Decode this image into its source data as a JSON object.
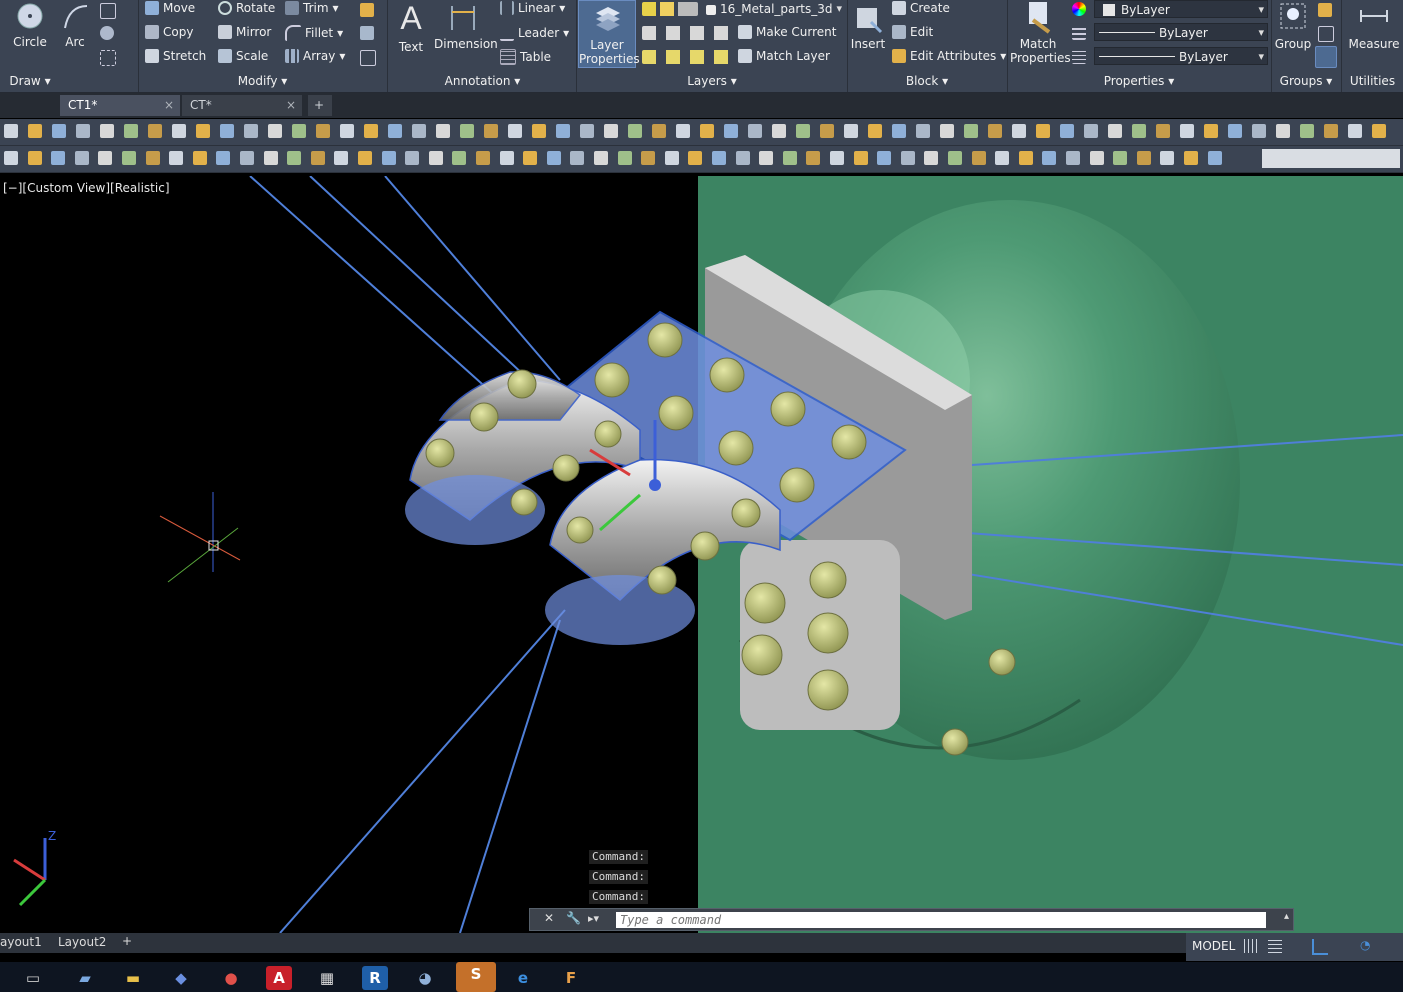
{
  "ribbon": {
    "draw": {
      "circle": "Circle",
      "arc": "Arc",
      "panel": "Draw"
    },
    "modify": {
      "move": "Move",
      "rotate": "Rotate",
      "trim": "Trim",
      "copy": "Copy",
      "mirror": "Mirror",
      "fillet": "Fillet",
      "stretch": "Stretch",
      "scale": "Scale",
      "array": "Array",
      "panel": "Modify"
    },
    "annotation": {
      "text": "Text",
      "dimension": "Dimension",
      "linear": "Linear",
      "leader": "Leader",
      "table": "Table",
      "panel": "Annotation"
    },
    "layers": {
      "layer_properties_1": "Layer",
      "layer_properties_2": "Properties",
      "current_layer": "16_Metal_parts_3d",
      "make_current": "Make Current",
      "match_layer": "Match Layer",
      "panel": "Layers"
    },
    "block": {
      "insert": "Insert",
      "create": "Create",
      "edit": "Edit",
      "edit_attributes": "Edit Attributes",
      "panel": "Block"
    },
    "properties": {
      "match_1": "Match",
      "match_2": "Properties",
      "color": "ByLayer",
      "linetype": "ByLayer",
      "lineweight": "ByLayer",
      "panel": "Properties"
    },
    "groups": {
      "group": "Group",
      "panel": "Groups"
    },
    "utilities": {
      "measure": "Measure",
      "panel": "Utilities"
    }
  },
  "tabs": [
    {
      "label": "CT1*",
      "close": "×"
    },
    {
      "label": "CT*",
      "close": "×"
    }
  ],
  "new_tab": "+",
  "viewport": {
    "label": "[−][Custom View][Realistic]"
  },
  "command": {
    "history": [
      "Command:",
      "Command:",
      "Command:"
    ],
    "placeholder": "Type a command"
  },
  "layout_tabs": [
    "ayout1",
    "Layout2"
  ],
  "status": {
    "model": "MODEL"
  },
  "colors": {
    "ribbon": "#3b4453",
    "accent": "#4a8fd8",
    "plate": "#6f8fe0",
    "green_body": "#3f8a64"
  },
  "icons": [
    "circle-icon",
    "arc-icon",
    "move-icon",
    "rotate-icon",
    "trim-icon",
    "copy-icon",
    "mirror-icon",
    "fillet-icon",
    "stretch-icon",
    "scale-icon",
    "array-icon",
    "text-icon",
    "dimension-icon",
    "layer-properties-icon",
    "insert-icon",
    "match-properties-icon",
    "group-icon",
    "measure-icon"
  ]
}
